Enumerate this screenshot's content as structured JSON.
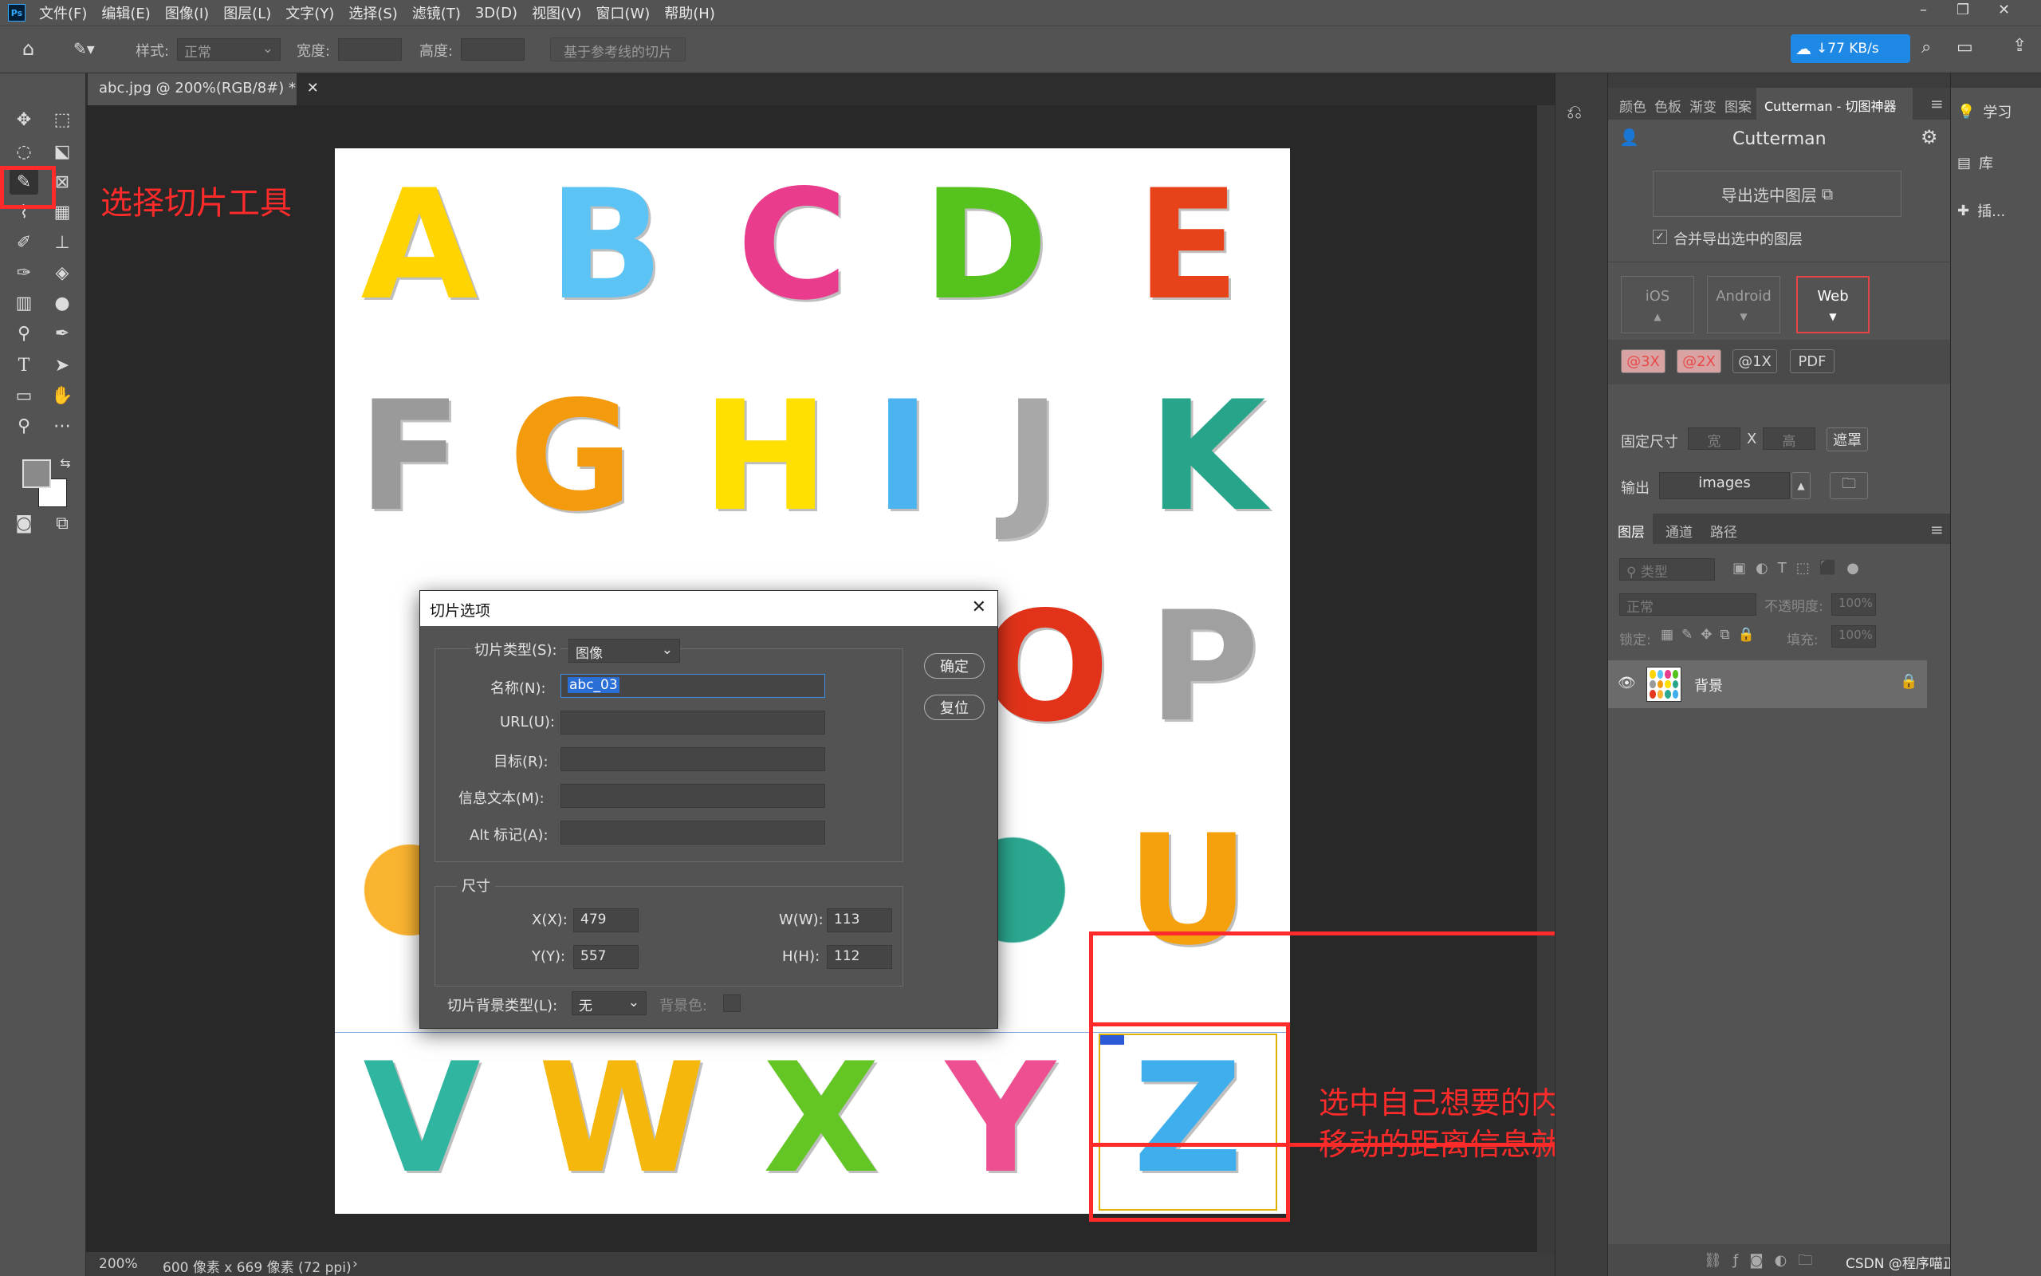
{
  "menubar": {
    "app_icon": "Ps",
    "items": [
      "文件(F)",
      "编辑(E)",
      "图像(I)",
      "图层(L)",
      "文字(Y)",
      "选择(S)",
      "滤镜(T)",
      "3D(D)",
      "视图(V)",
      "窗口(W)",
      "帮助(H)"
    ]
  },
  "options": {
    "style_label": "样式:",
    "style_value": "正常",
    "width_label": "宽度:",
    "height_label": "高度:",
    "guides_button": "基于参考线的切片",
    "speed": "77 KB/s"
  },
  "document": {
    "tab_title": "abc.jpg @ 200%(RGB/8#) *",
    "zoom": "200%",
    "info": "600 像素 x 669 像素 (72 ppi)"
  },
  "image_letters": [
    "A",
    "B",
    "C",
    "D",
    "E",
    "F",
    "G",
    "H",
    "I",
    "J",
    "K",
    "O",
    "P",
    "U",
    "V",
    "W",
    "X",
    "Y",
    "Z"
  ],
  "annotations": {
    "tool_hint": "选择切片工具",
    "desc_line1": "选中自己想要的内容，然后双击，宽高和精灵图要",
    "desc_line2": "移动的距离信息就得到了"
  },
  "dialog": {
    "title": "切片选项",
    "slice_type_label": "切片类型(S):",
    "slice_type_value": "图像",
    "name_label": "名称(N):",
    "name_value": "abc_03",
    "url_label": "URL(U):",
    "target_label": "目标(R):",
    "message_label": "信息文本(M):",
    "alt_label": "Alt 标记(A):",
    "ok": "确定",
    "reset": "复位",
    "dimensions_title": "尺寸",
    "x_label": "X(X):",
    "x_value": "479",
    "y_label": "Y(Y):",
    "y_value": "557",
    "w_label": "W(W):",
    "w_value": "113",
    "h_label": "H(H):",
    "h_value": "112",
    "bg_type_label": "切片背景类型(L):",
    "bg_type_value": "无",
    "bg_color_label": "背景色:"
  },
  "panel": {
    "tabs": [
      "颜色",
      "色板",
      "渐变",
      "图案",
      "Cutterman - 切图神器"
    ],
    "cutterman_title": "Cutterman",
    "export_button": "导出选中图层",
    "merge_label": "合并导出选中的图层",
    "platforms": [
      "iOS",
      "Android",
      "Web"
    ],
    "scales": [
      "@3X",
      "@2X",
      "@1X",
      "PDF"
    ],
    "fixed_size_label": "固定尺寸",
    "width_ph": "宽",
    "x_sep": "X",
    "height_ph": "高",
    "mask_button": "遮罩",
    "output_label": "输出",
    "output_value": "images",
    "layer_tabs": [
      "图层",
      "通道",
      "路径"
    ],
    "kind_ph": "类型",
    "blend_mode": "正常",
    "opacity_label": "不透明度:",
    "opacity_value": "100%",
    "lock_label": "锁定:",
    "fill_label": "填充:",
    "fill_value": "100%",
    "layer_name": "背景",
    "footer_watermark": "CSDN @程序喵正在路上"
  },
  "right_column": {
    "items": [
      "学习",
      "库",
      "插..."
    ]
  }
}
